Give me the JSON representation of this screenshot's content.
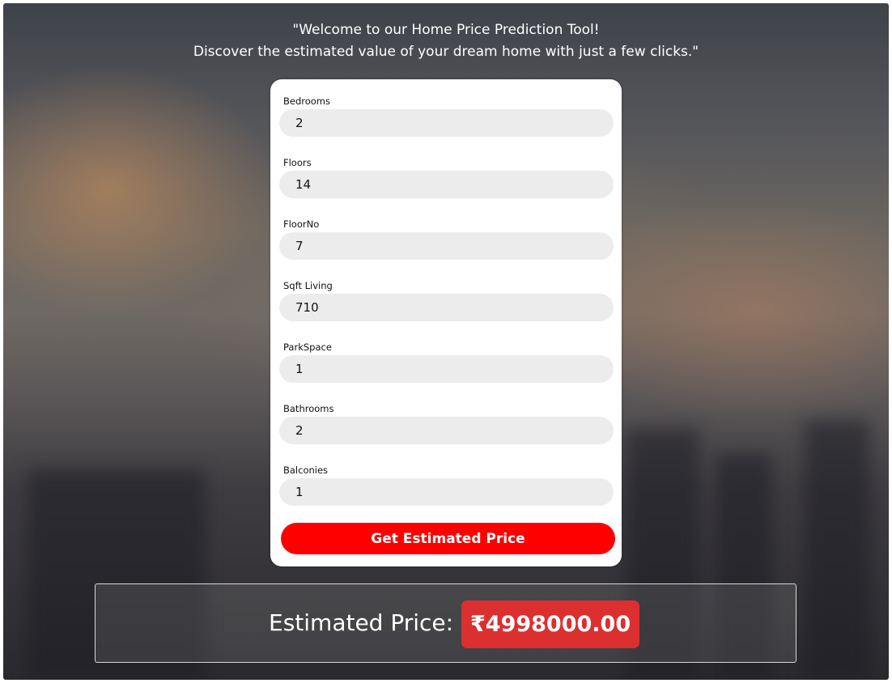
{
  "header": {
    "line1": "\"Welcome to our Home Price Prediction Tool!",
    "line2": "Discover the estimated value of your dream home with just a few clicks.\""
  },
  "form": {
    "fields": [
      {
        "label": "Bedrooms",
        "value": "2"
      },
      {
        "label": "Floors",
        "value": "14"
      },
      {
        "label": "FloorNo",
        "value": "7"
      },
      {
        "label": "Sqft Living",
        "value": "710"
      },
      {
        "label": "ParkSpace",
        "value": "1"
      },
      {
        "label": "Bathrooms",
        "value": "2"
      },
      {
        "label": "Balconies",
        "value": "1"
      }
    ],
    "submit_label": "Get Estimated Price"
  },
  "result": {
    "label": "Estimated Price:",
    "value": "₹4998000.00"
  },
  "colors": {
    "button": "#ff0000",
    "price_badge": "#dc2f2f",
    "input_bg": "#ececec"
  }
}
